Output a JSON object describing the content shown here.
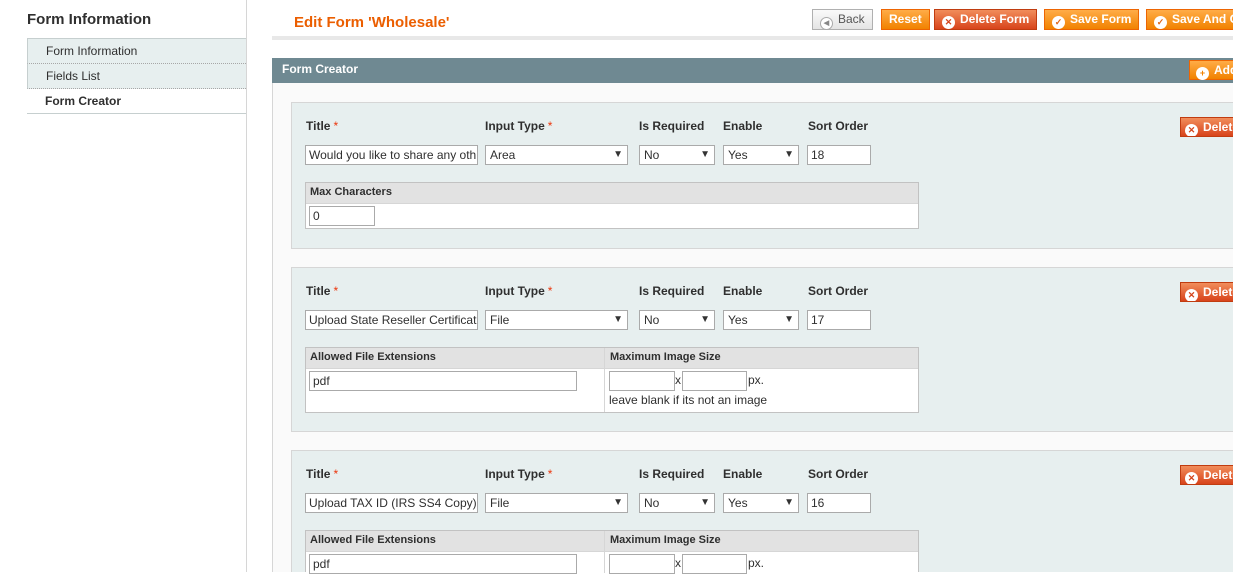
{
  "sidebar": {
    "title": "Form Information",
    "items": [
      {
        "label": "Form Information"
      },
      {
        "label": "Fields List"
      },
      {
        "label": "Form Creator"
      }
    ]
  },
  "header": {
    "title": "Edit Form 'Wholesale'",
    "buttons": {
      "back": "Back",
      "reset": "Reset",
      "delete": "Delete Form",
      "save": "Save Form",
      "save_continue": "Save And C"
    }
  },
  "section": {
    "title": "Form Creator",
    "add_label": "Add"
  },
  "labels": {
    "title": "Title",
    "required_mark": "*",
    "input_type": "Input Type",
    "is_required": "Is Required",
    "enable": "Enable",
    "sort_order": "Sort Order",
    "delete": "Delete",
    "max_characters": "Max Characters",
    "allowed_ext": "Allowed File Extensions",
    "max_image_size": "Maximum Image Size",
    "x": "x",
    "px": "px.",
    "hint": "leave blank if its not an image"
  },
  "fields": [
    {
      "title": "Would you like to share any oth",
      "input_type": "Area",
      "is_required": "No",
      "enable": "Yes",
      "sort_order": "18",
      "max_characters": "0"
    },
    {
      "title": "Upload State Reseller Certificat",
      "input_type": "File",
      "is_required": "No",
      "enable": "Yes",
      "sort_order": "17",
      "extensions": "pdf",
      "width": "",
      "height": ""
    },
    {
      "title": "Upload TAX ID (IRS SS4 Copy)",
      "input_type": "File",
      "is_required": "No",
      "enable": "Yes",
      "sort_order": "16",
      "extensions": "pdf",
      "width": "",
      "height": ""
    }
  ],
  "colors": {
    "accent": "#eb5e00",
    "section_header": "#6f8992",
    "field_bg": "#e7efef"
  }
}
